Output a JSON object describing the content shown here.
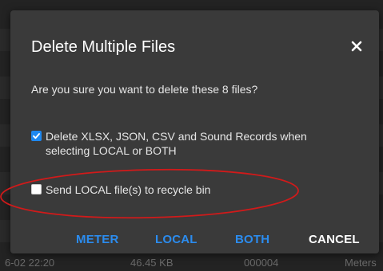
{
  "dialog": {
    "title": "Delete Multiple Files",
    "close_icon": "close-icon",
    "message": "Are you sure you want to delete these 8 files?",
    "options": [
      {
        "label": "Delete XLSX, JSON, CSV and Sound Records when selecting LOCAL or BOTH",
        "checked": true
      },
      {
        "label": "Send LOCAL file(s) to recycle bin",
        "checked": false
      }
    ],
    "buttons": {
      "meter": "METER",
      "local": "LOCAL",
      "both": "BOTH",
      "cancel": "CANCEL"
    }
  },
  "background_row": {
    "date": "6-02 22:20",
    "size": "46.45 KB",
    "id": "000004",
    "device": "Meters"
  },
  "colors": {
    "accent": "#2b8cef",
    "checkbox_checked": "#1e88f0",
    "annotation": "#d11a1a",
    "dialog_bg": "#3a3a3a"
  }
}
